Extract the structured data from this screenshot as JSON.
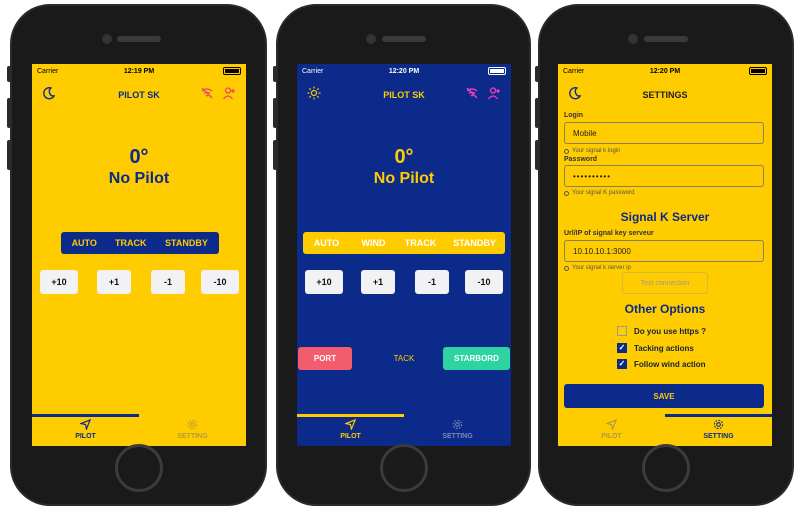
{
  "colors": {
    "yellow": "#ffcc00",
    "blue": "#0b2a8a",
    "port": "#f25c6c",
    "starboard": "#2dd4a0"
  },
  "phone1": {
    "status": {
      "carrier": "Carrier",
      "time": "12:19 PM"
    },
    "nav_title": "PILOT SK",
    "heading_value": "0°",
    "heading_status": "No Pilot",
    "modes": [
      "AUTO",
      "TRACK",
      "STANDBY"
    ],
    "steps": [
      "+10",
      "+1",
      "-1",
      "-10"
    ],
    "tabs": {
      "pilot": "PILOT",
      "setting": "SETTING"
    }
  },
  "phone2": {
    "status": {
      "carrier": "Carrier",
      "time": "12:20 PM"
    },
    "nav_title": "PILOT SK",
    "heading_value": "0°",
    "heading_status": "No Pilot",
    "modes": [
      "AUTO",
      "WIND",
      "TRACK",
      "STANDBY"
    ],
    "steps": [
      "+10",
      "+1",
      "-1",
      "-10"
    ],
    "port": "PORT",
    "tack": "TACK",
    "starboard": "STARBORD",
    "tabs": {
      "pilot": "PILOT",
      "setting": "SETTING"
    }
  },
  "phone3": {
    "status": {
      "carrier": "Carrier",
      "time": "12:20 PM"
    },
    "nav_title": "SETTINGS",
    "login_label": "Login",
    "login_value": "Mobile",
    "login_hint": "Your signal k login",
    "password_label": "Password",
    "password_value": "••••••••••",
    "password_hint": "Your signal K password",
    "server_title": "Signal K Server",
    "url_label": "Url/IP of signal key serveur",
    "url_value": "10.10.10.1:3000",
    "url_hint": "Your signal k server ip",
    "test_button": "Test connection",
    "other_title": "Other Options",
    "options": [
      {
        "label": "Do you use https ?",
        "checked": false
      },
      {
        "label": "Tacking actions",
        "checked": true
      },
      {
        "label": "Follow wind action",
        "checked": true
      }
    ],
    "save": "SAVE",
    "tabs": {
      "pilot": "PILOT",
      "setting": "SETTING"
    }
  }
}
